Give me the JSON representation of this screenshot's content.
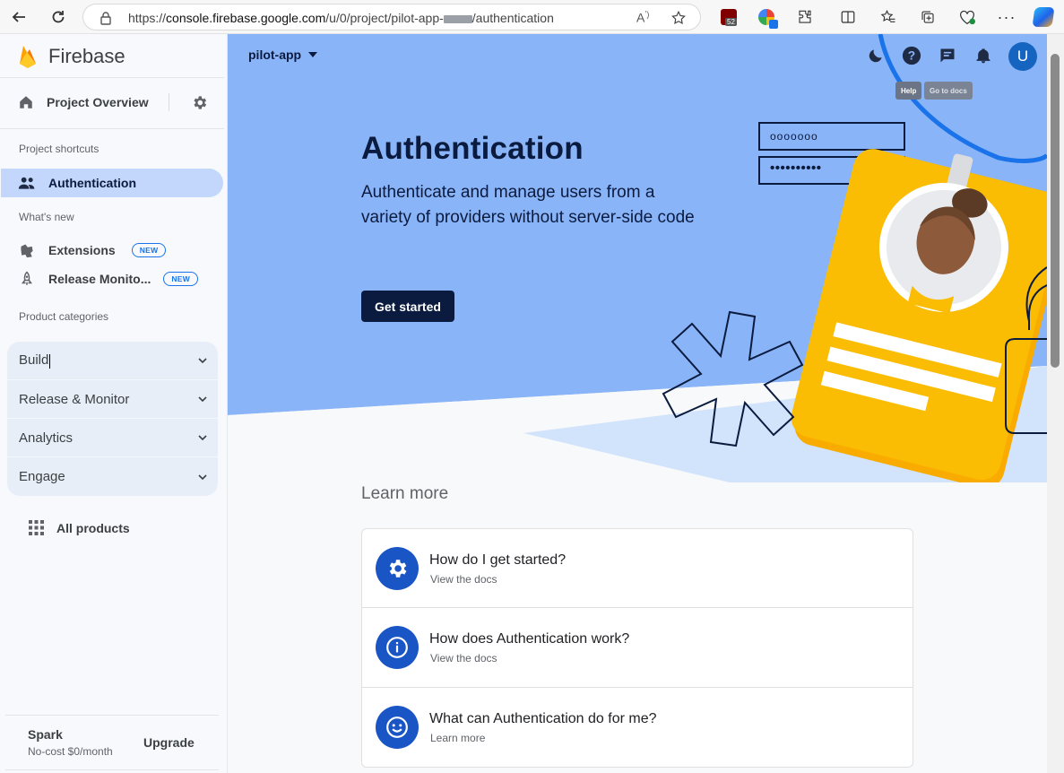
{
  "browser": {
    "url_prefix": "https://",
    "url_host": "console.firebase.google.com",
    "url_path": "/u/0/project/pilot-app-",
    "url_suffix": "/authentication",
    "ext_badge": "52"
  },
  "sidebar": {
    "brand": "Firebase",
    "project_overview": "Project Overview",
    "shortcuts_label": "Project shortcuts",
    "active_item": "Authentication",
    "whats_new_label": "What's new",
    "new_items": [
      {
        "label": "Extensions",
        "badge": "NEW"
      },
      {
        "label": "Release Monito...",
        "badge": "NEW"
      }
    ],
    "categories_label": "Product categories",
    "categories": [
      "Build",
      "Release & Monitor",
      "Analytics",
      "Engage"
    ],
    "all_products": "All products",
    "plan_name": "Spark",
    "plan_desc": "No-cost $0/month",
    "upgrade": "Upgrade"
  },
  "header": {
    "project": "pilot-app",
    "avatar_letter": "U",
    "tooltip_help": "Help",
    "tooltip_docs": "Go to docs"
  },
  "hero": {
    "title": "Authentication",
    "subtitle": "Authenticate and manage users from a variety of providers without server-side code",
    "cta": "Get started",
    "field_text": "ooooooo",
    "field_password": "••••••••••"
  },
  "learn": {
    "title": "Learn more",
    "cards": [
      {
        "title": "How do I get started?",
        "sub": "View the docs",
        "icon": "gear-icon"
      },
      {
        "title": "How does Authentication work?",
        "sub": "View the docs",
        "icon": "info-icon"
      },
      {
        "title": "What can Authentication do for me?",
        "sub": "Learn more",
        "icon": "smile-icon"
      }
    ]
  },
  "colors": {
    "hero_bg": "#8ab4f8",
    "navy": "#0b1b3f",
    "accent": "#1a73e8",
    "active_bg": "#c2d7fb",
    "badge_yellow": "#fbbc04"
  }
}
